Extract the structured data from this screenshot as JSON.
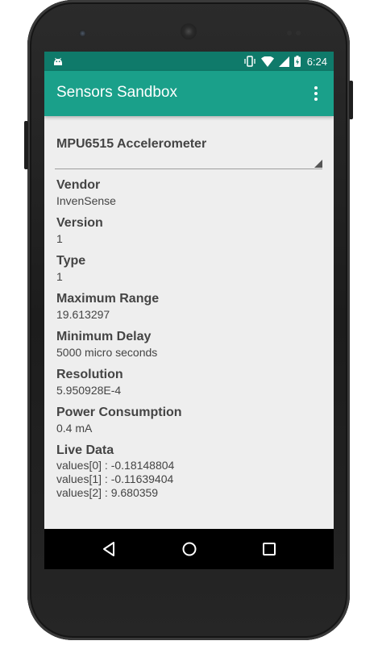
{
  "status_bar": {
    "time": "6:24",
    "icons": [
      "android-debug-icon",
      "vibrate-icon",
      "wifi-icon",
      "cell-signal-icon",
      "battery-charging-icon"
    ]
  },
  "toolbar": {
    "title": "Sensors Sandbox",
    "overflow_icon": "more-vert-icon"
  },
  "sensor_selector": {
    "selected": "MPU6515 Accelerometer"
  },
  "properties": [
    {
      "label": "Vendor",
      "value": "InvenSense"
    },
    {
      "label": "Version",
      "value": "1"
    },
    {
      "label": "Type",
      "value": "1"
    },
    {
      "label": "Maximum Range",
      "value": "19.613297"
    },
    {
      "label": "Minimum Delay",
      "value": "5000 micro seconds"
    },
    {
      "label": "Resolution",
      "value": "5.950928E-4"
    },
    {
      "label": "Power Consumption",
      "value": "0.4 mA"
    }
  ],
  "live_data": {
    "label": "Live Data",
    "values": [
      "values[0] : -0.18148804",
      "values[1] : -0.11639404",
      "values[2] : 9.680359"
    ]
  },
  "nav_bar": {
    "buttons": [
      "back-icon",
      "home-icon",
      "recents-icon"
    ]
  },
  "colors": {
    "status_bar": "#0f7a6a",
    "toolbar": "#1aa08a",
    "content_bg": "#eeeeee",
    "text": "#444444"
  }
}
